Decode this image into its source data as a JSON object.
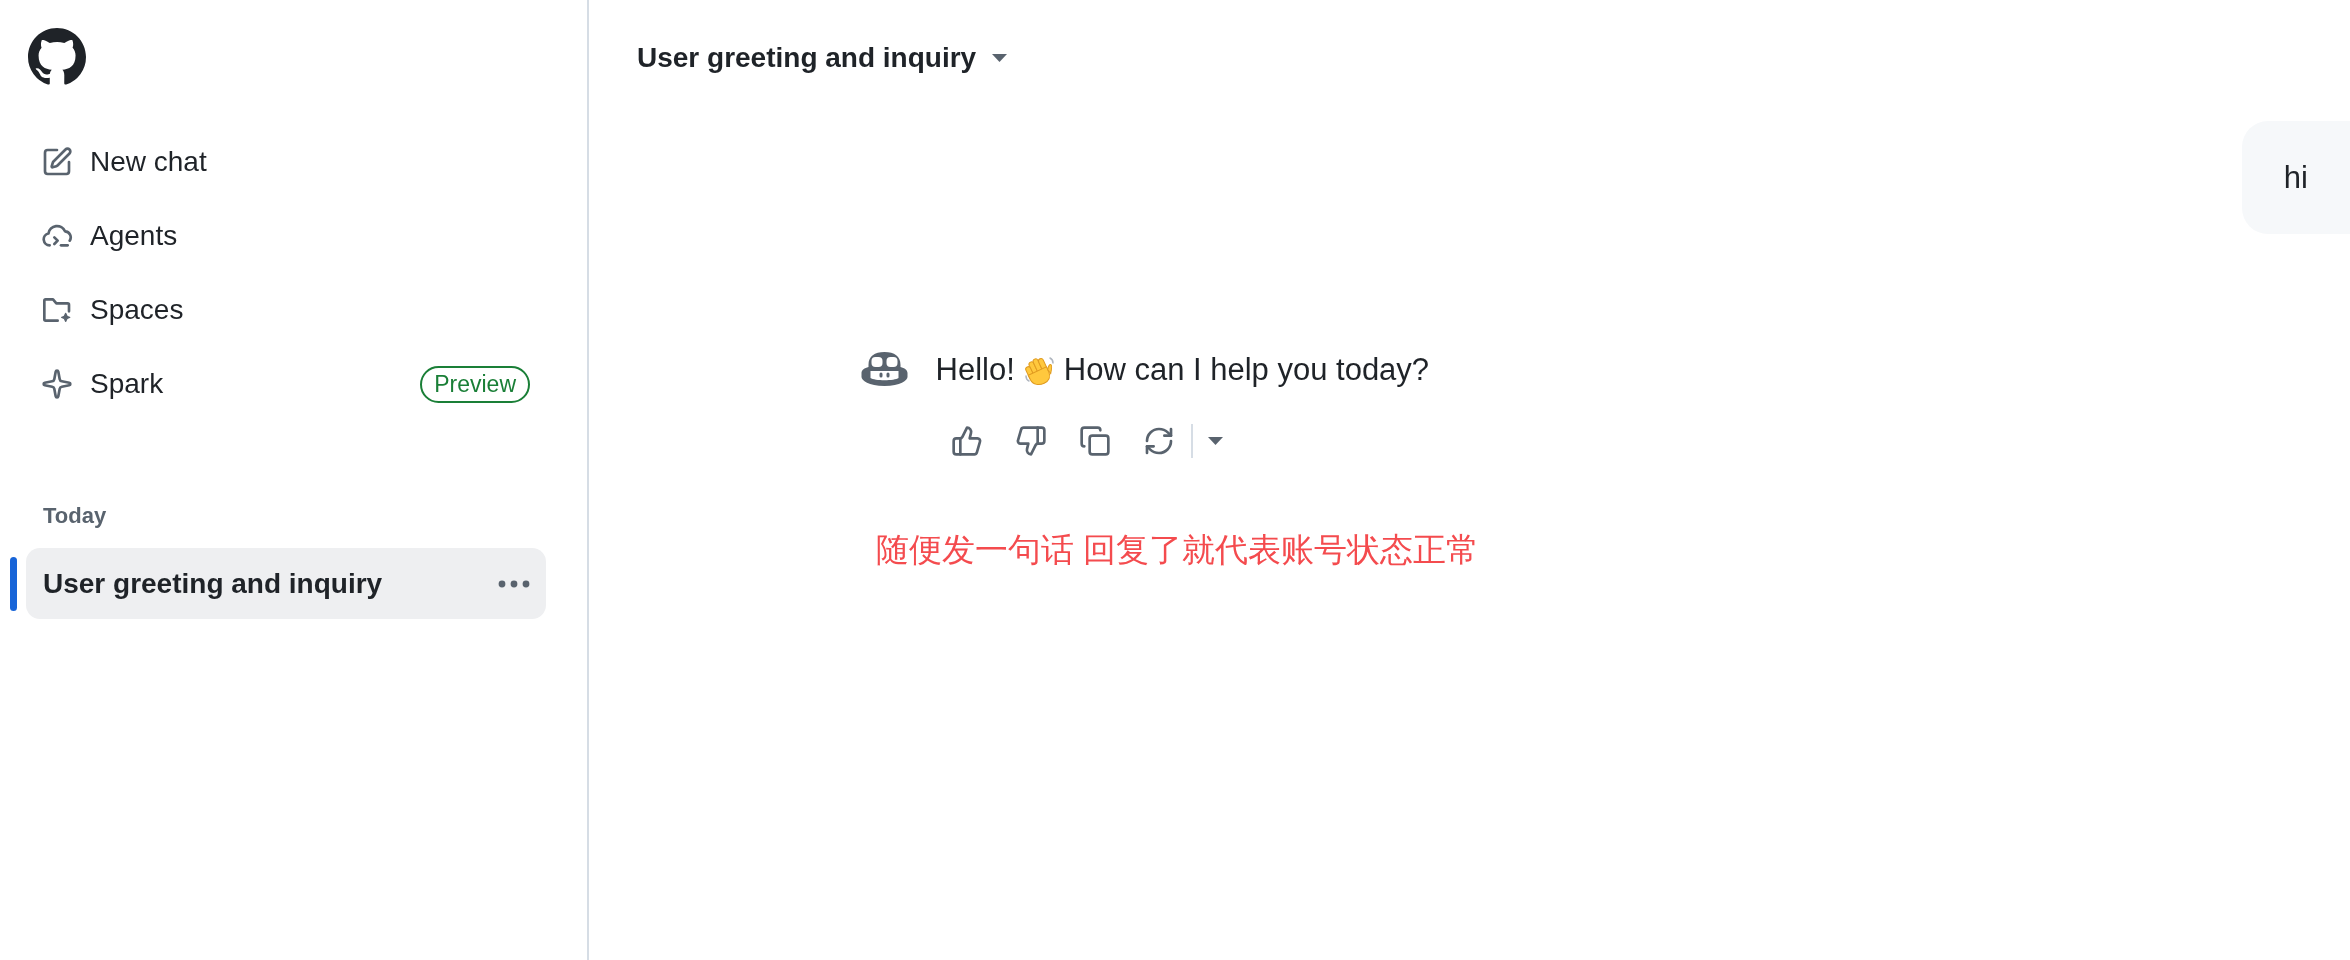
{
  "sidebar": {
    "nav_items": [
      {
        "kind": "new_chat",
        "label": "New chat"
      },
      {
        "kind": "agents",
        "label": "Agents"
      },
      {
        "kind": "spaces",
        "label": "Spaces"
      },
      {
        "kind": "spark",
        "label": "Spark",
        "badge": "Preview"
      }
    ],
    "sections": [
      {
        "heading": "Today",
        "chats": [
          {
            "title": "User greeting and inquiry",
            "selected": true
          }
        ]
      }
    ]
  },
  "header": {
    "title": "User greeting and inquiry"
  },
  "messages": [
    {
      "kind": "user",
      "text": "hi"
    },
    {
      "kind": "assistant",
      "text_before": "Hello!",
      "text_after": "How can I help you today?",
      "actions": [
        {
          "kind": "thumbs_up"
        },
        {
          "kind": "thumbs_down"
        },
        {
          "kind": "copy"
        },
        {
          "kind": "retry"
        }
      ]
    }
  ],
  "annotation": "随便发一句话 回复了就代表账号状态正常"
}
